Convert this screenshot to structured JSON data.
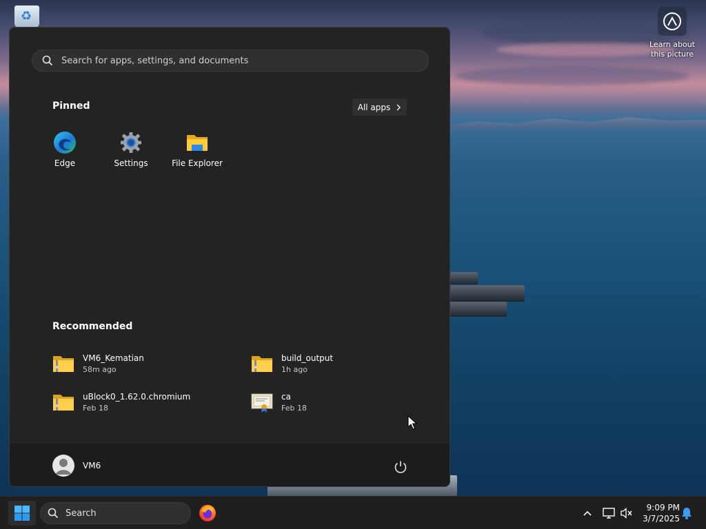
{
  "desktop": {
    "learn_label": "Learn about this picture"
  },
  "start_menu": {
    "search_placeholder": "Search for apps, settings, and documents",
    "pinned_title": "Pinned",
    "all_apps_label": "All apps",
    "pinned": [
      {
        "label": "Edge",
        "icon": "edge-icon"
      },
      {
        "label": "Settings",
        "icon": "gear-icon"
      },
      {
        "label": "File Explorer",
        "icon": "folder-icon"
      }
    ],
    "recommended_title": "Recommended",
    "recommended": [
      {
        "name": "VM6_Kematian",
        "time": "58m ago",
        "icon": "zip-folder-icon"
      },
      {
        "name": "build_output",
        "time": "1h ago",
        "icon": "zip-folder-icon"
      },
      {
        "name": "uBlock0_1.62.0.chromium",
        "time": "Feb 18",
        "icon": "zip-folder-icon"
      },
      {
        "name": "ca",
        "time": "Feb 18",
        "icon": "certificate-icon"
      }
    ],
    "user_name": "VM6"
  },
  "taskbar": {
    "search_placeholder": "Search",
    "time": "9:09 PM",
    "date": "3/7/2025"
  },
  "colors": {
    "menu_bg": "#232323",
    "taskbar_bg": "#1f1f1f",
    "accent": "#3b9cf0"
  }
}
